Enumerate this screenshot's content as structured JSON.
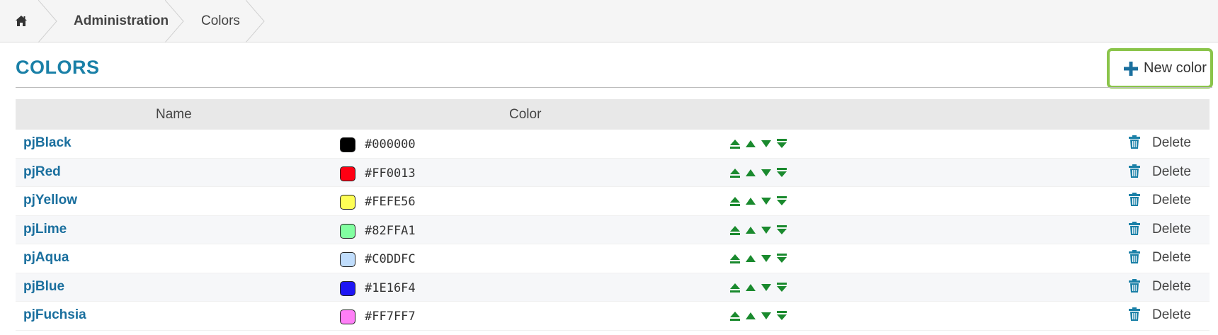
{
  "breadcrumb": {
    "home_icon": "home-icon",
    "items": [
      "Administration",
      "Colors"
    ]
  },
  "header": {
    "title": "COLORS",
    "new_button_label": "New color",
    "new_button_icon": "plus-icon"
  },
  "table": {
    "columns": [
      "Name",
      "Color"
    ],
    "delete_label": "Delete",
    "rows": [
      {
        "name": "pjBlack",
        "hex": "#000000"
      },
      {
        "name": "pjRed",
        "hex": "#FF0013"
      },
      {
        "name": "pjYellow",
        "hex": "#FEFE56"
      },
      {
        "name": "pjLime",
        "hex": "#82FFA1"
      },
      {
        "name": "pjAqua",
        "hex": "#C0DDFC"
      },
      {
        "name": "pjBlue",
        "hex": "#1E16F4"
      },
      {
        "name": "pjFuchsia",
        "hex": "#FF7FF7"
      }
    ]
  },
  "colors": {
    "title": "#1a80a7",
    "link": "#1a6f9e",
    "arrow": "#1a8a2e",
    "trash": "#1a80a7",
    "highlight": "#8ac44a"
  }
}
